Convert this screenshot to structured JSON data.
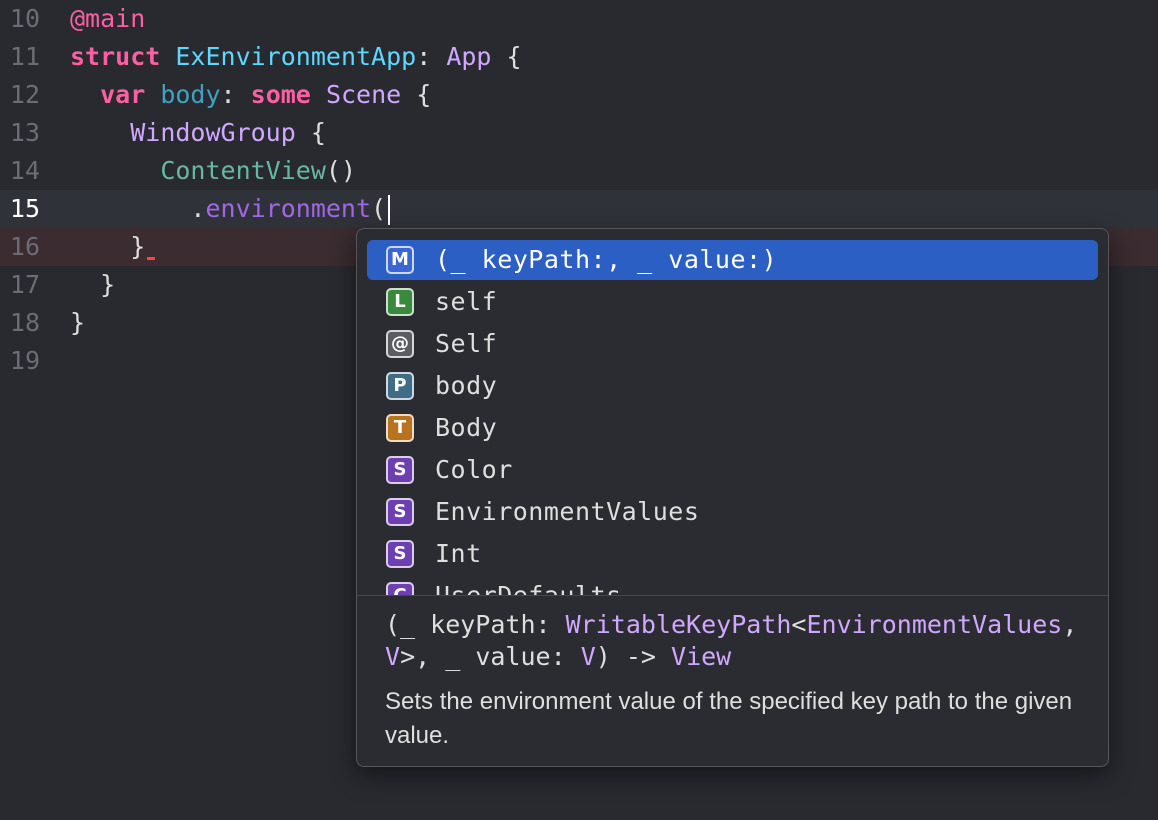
{
  "editor": {
    "lines": [
      {
        "number": "10",
        "tokens": [
          {
            "text": "@main",
            "cls": "deco"
          }
        ]
      },
      {
        "number": "11",
        "tokens": [
          {
            "text": "struct",
            "cls": "kw"
          },
          {
            "text": " ",
            "cls": "plain"
          },
          {
            "text": "ExEnvironmentApp",
            "cls": "type-decl"
          },
          {
            "text": ": ",
            "cls": "plain"
          },
          {
            "text": "App",
            "cls": "type"
          },
          {
            "text": " {",
            "cls": "plain"
          }
        ]
      },
      {
        "number": "12",
        "tokens": [
          {
            "text": "  ",
            "cls": "plain"
          },
          {
            "text": "var",
            "cls": "kw"
          },
          {
            "text": " ",
            "cls": "plain"
          },
          {
            "text": "body",
            "cls": "id-decl"
          },
          {
            "text": ": ",
            "cls": "plain"
          },
          {
            "text": "some",
            "cls": "kw"
          },
          {
            "text": " ",
            "cls": "plain"
          },
          {
            "text": "Scene",
            "cls": "type"
          },
          {
            "text": " {",
            "cls": "plain"
          }
        ]
      },
      {
        "number": "13",
        "tokens": [
          {
            "text": "    ",
            "cls": "plain"
          },
          {
            "text": "WindowGroup",
            "cls": "type"
          },
          {
            "text": " {",
            "cls": "plain"
          }
        ]
      },
      {
        "number": "14",
        "tokens": [
          {
            "text": "      ",
            "cls": "plain"
          },
          {
            "text": "ContentView",
            "cls": "fn"
          },
          {
            "text": "()",
            "cls": "plain"
          }
        ]
      },
      {
        "number": "15",
        "tokens": [
          {
            "text": "        .",
            "cls": "plain"
          },
          {
            "text": "environment",
            "cls": "mem"
          },
          {
            "text": "(",
            "cls": "plain"
          }
        ]
      },
      {
        "number": "16",
        "tokens": [
          {
            "text": "    }",
            "cls": "plain"
          }
        ]
      },
      {
        "number": "17",
        "tokens": [
          {
            "text": "  }",
            "cls": "plain"
          }
        ]
      },
      {
        "number": "18",
        "tokens": [
          {
            "text": "}",
            "cls": "plain"
          }
        ]
      },
      {
        "number": "19",
        "tokens": []
      }
    ]
  },
  "completion": {
    "items": [
      {
        "badge": "M",
        "label": "(_ keyPath:, _ value:)"
      },
      {
        "badge": "L",
        "label": "self"
      },
      {
        "badge": "@",
        "label": "Self"
      },
      {
        "badge": "P",
        "label": "body"
      },
      {
        "badge": "T",
        "label": "Body"
      },
      {
        "badge": "S",
        "label": "Color"
      },
      {
        "badge": "S",
        "label": "EnvironmentValues"
      },
      {
        "badge": "S",
        "label": "Int"
      },
      {
        "badge": "C",
        "label": "UserDefaults"
      }
    ],
    "signature": {
      "prefix": "(_ keyPath: ",
      "type1": "WritableKeyPath",
      "lt": "<",
      "type2": "EnvironmentValues",
      "sep": ", ",
      "type3": "V",
      "middle": ">, _ value: ",
      "type4": "V",
      "arrow": ") -> ",
      "type5": "View"
    },
    "description": "Sets the environment value of the specified key path to the given value."
  },
  "colors": {
    "background": "#292a30",
    "selection": "#2c5fc4",
    "keyword": "#fc5fa3",
    "type": "#d0a8ff"
  }
}
